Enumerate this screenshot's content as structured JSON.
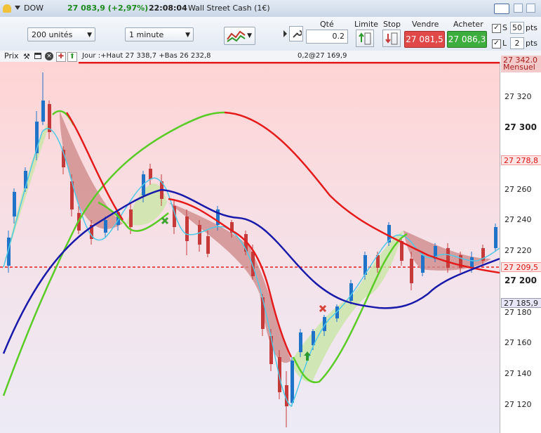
{
  "titlebar": {
    "instrument": "DOW",
    "price": "27 083,9 (+2,97%)",
    "time": "22:08:04",
    "name": "Wall Street Cash (1€)"
  },
  "toolbar": {
    "units": "200 unités",
    "interval": "1 minute",
    "qty_label": "Qté",
    "qty_value": "0.2",
    "limit_label": "Limite",
    "stop_label": "Stop",
    "sell_label": "Vendre",
    "sell_price": "27 081,5",
    "buy_label": "Acheter",
    "buy_price": "27 086,3",
    "s_label": "S",
    "s_value": "50",
    "l_label": "L",
    "l_value": "2",
    "pts": "pts"
  },
  "prixbar": {
    "label": "Prix",
    "info": "Jour :+Haut 27 338,7 +Bas 26 232,8",
    "cursor": "0,2@27 169,9"
  },
  "axis": {
    "ticks": [
      "27 320",
      "27 300",
      "27 260",
      "27 240",
      "27 220",
      "27 200",
      "27 180",
      "27 160",
      "27 140",
      "27 120"
    ],
    "tags": {
      "mensuel_value": "27 342,0",
      "mensuel_label": "Mensuel",
      "top_red": "27 278,8",
      "current": "27 209,5",
      "blue": "27 185,9"
    }
  },
  "colors": {
    "bull": "#1f73c9",
    "bear": "#c63a3a",
    "fast": "#4fc9e6",
    "green_line": "#59cc25",
    "red_line": "#e51b1b",
    "blue_line": "#1a1aaa",
    "sell_btn": "#e14848",
    "buy_btn": "#3dae3d"
  }
}
